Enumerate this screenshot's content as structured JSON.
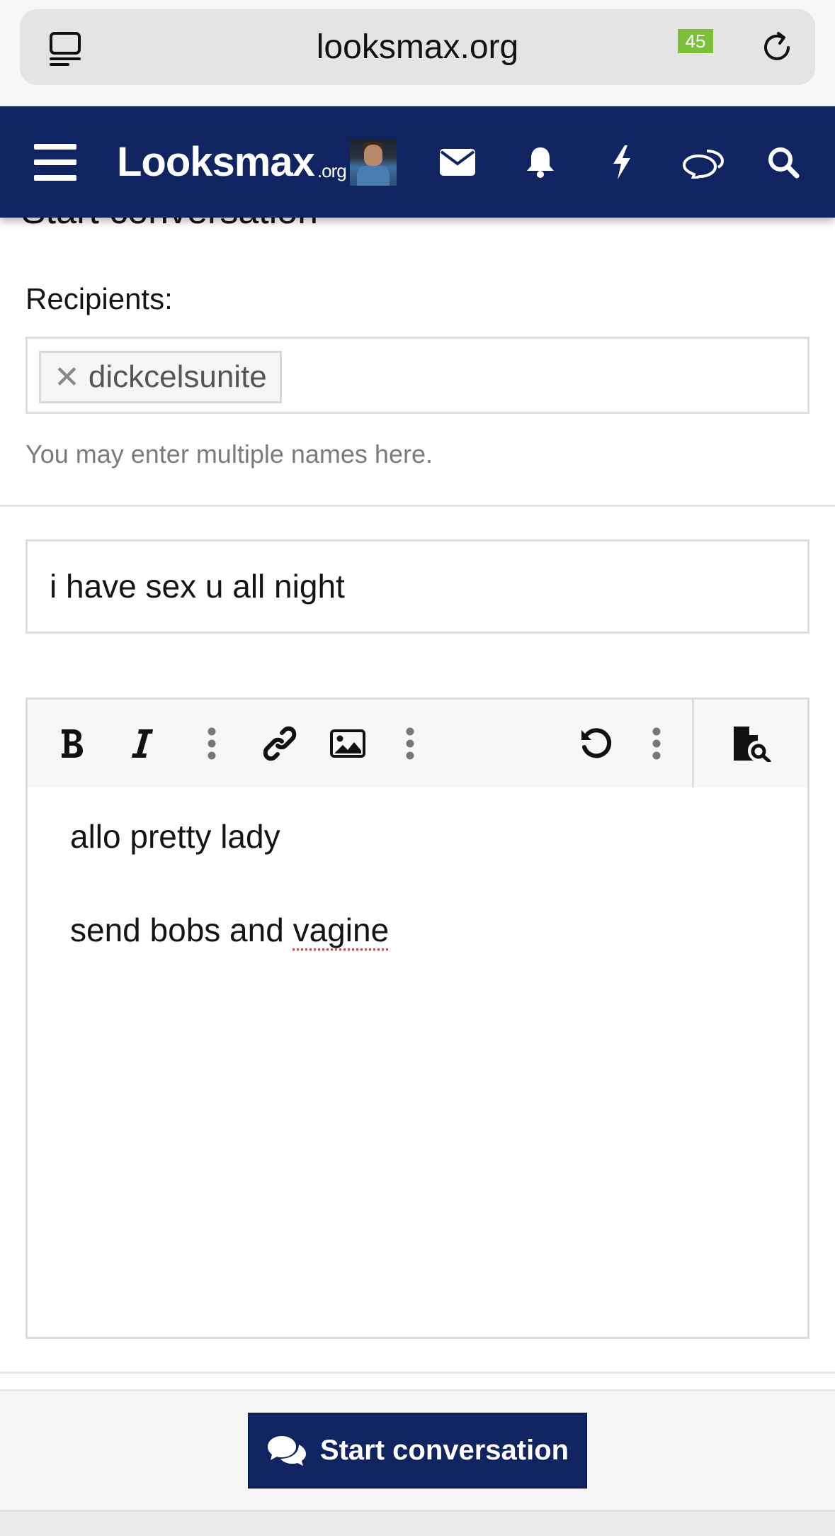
{
  "browser": {
    "url": "looksmax.org",
    "left_icon": "reader-icon",
    "right_icon": "reload-icon"
  },
  "header": {
    "logo_main": "Looksmax",
    "logo_suffix": ".org",
    "icons": [
      "menu-icon",
      "avatar",
      "mail-icon",
      "bell-icon",
      "bolt-icon",
      "chat-icon",
      "search-icon"
    ],
    "chat_badge": "45",
    "colors": {
      "header_bg": "#0f2460",
      "badge_bg": "#7cc03a"
    }
  },
  "page": {
    "title": "Start conversation"
  },
  "recipients": {
    "label": "Recipients:",
    "token": "dickcelsunite",
    "hint": "You may enter multiple names here."
  },
  "conversation": {
    "title_value": "i have sex u all night"
  },
  "editor": {
    "toolbar": [
      "bold-icon",
      "italic-icon",
      "more-vertical-icon",
      "link-icon",
      "image-icon",
      "more-vertical-icon",
      "undo-icon",
      "more-vertical-icon",
      "preview-icon"
    ],
    "line1": "allo pretty lady",
    "line2_pre": "send bobs and ",
    "line2_misspelled": "vagine"
  },
  "footer": {
    "submit_label": "Start conversation",
    "submit_icon": "comments-icon"
  }
}
